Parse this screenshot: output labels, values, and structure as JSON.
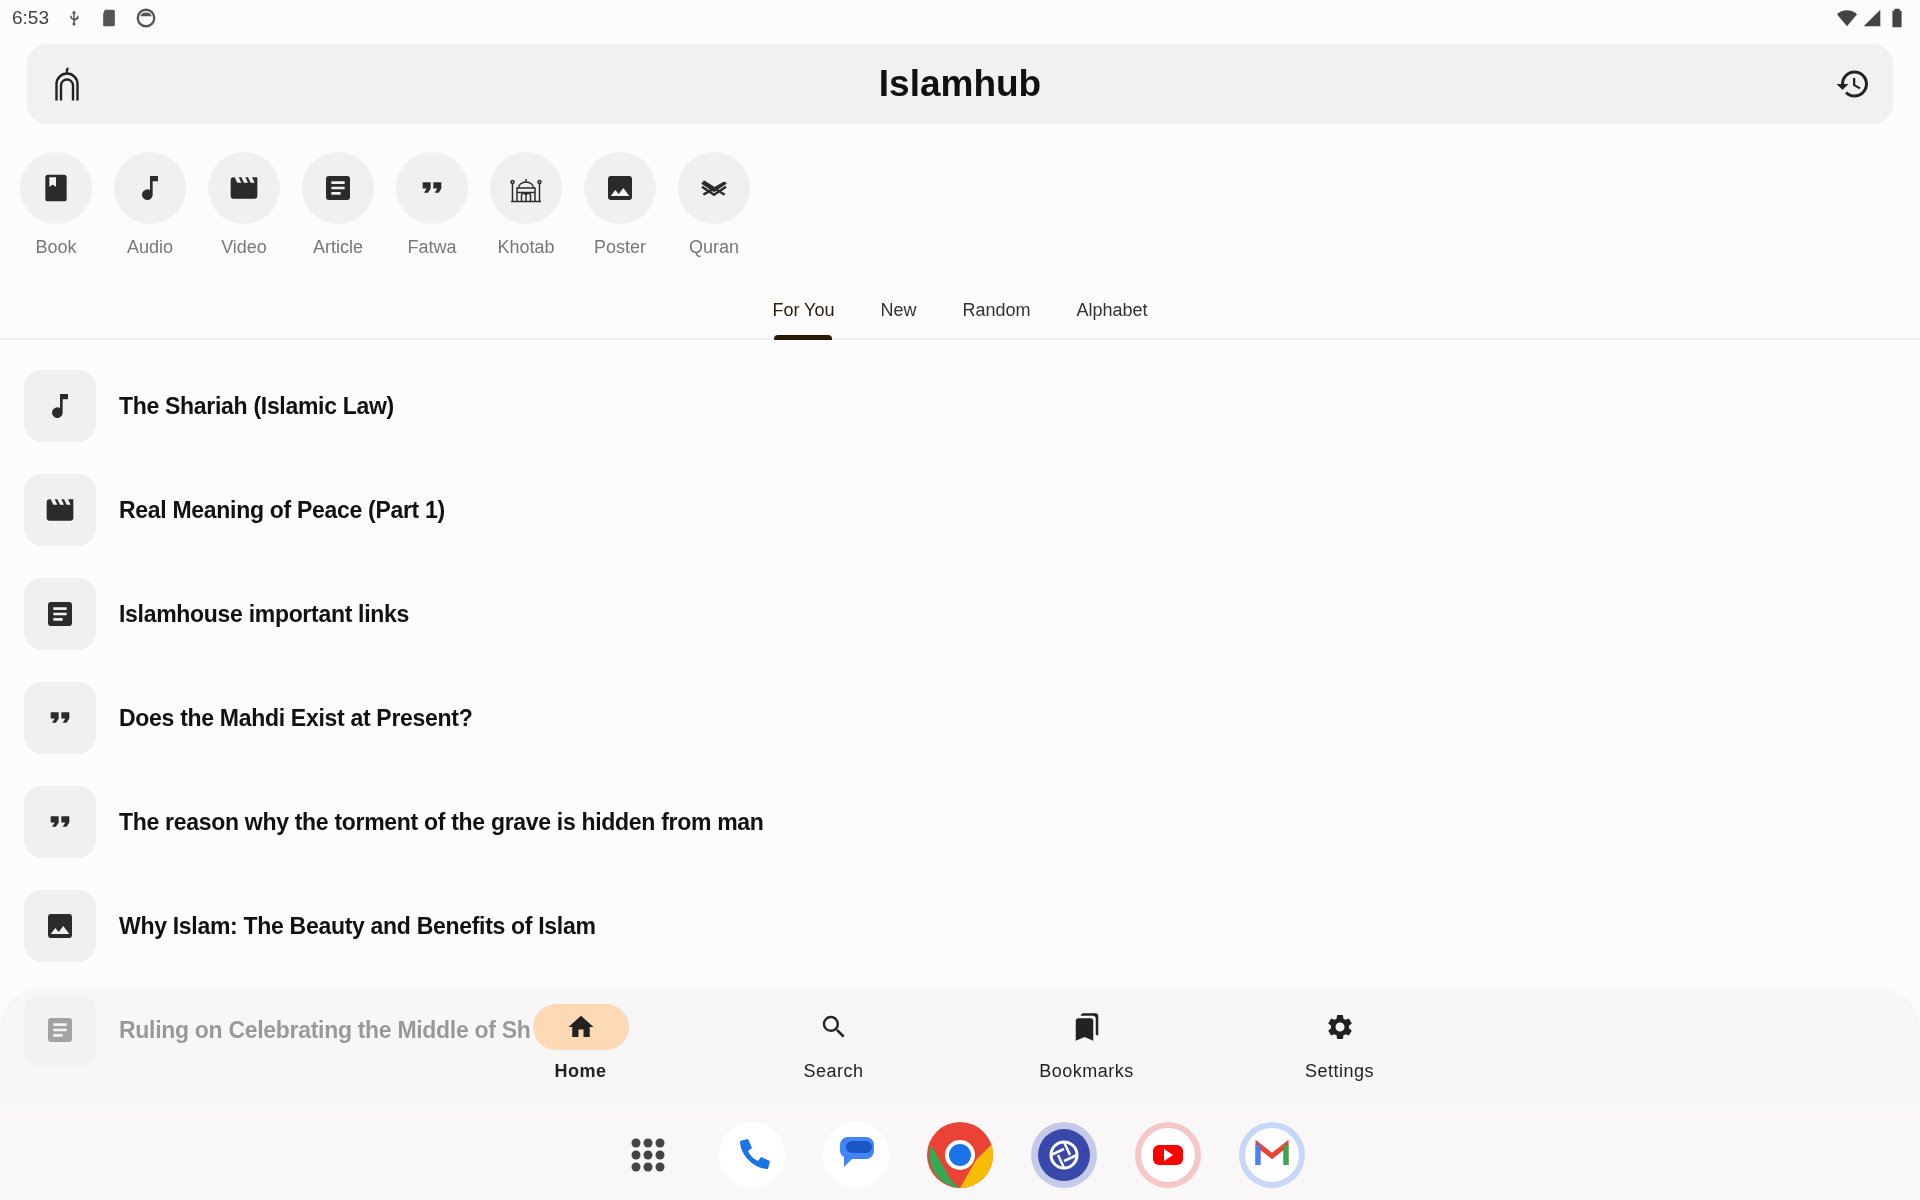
{
  "status_bar": {
    "time": "6:53"
  },
  "app_bar": {
    "title": "Islamhub"
  },
  "categories": [
    {
      "label": "Book",
      "kind": "book"
    },
    {
      "label": "Audio",
      "kind": "audio"
    },
    {
      "label": "Video",
      "kind": "video"
    },
    {
      "label": "Article",
      "kind": "article"
    },
    {
      "label": "Fatwa",
      "kind": "fatwa"
    },
    {
      "label": "Khotab",
      "kind": "khotab"
    },
    {
      "label": "Poster",
      "kind": "poster"
    },
    {
      "label": "Quran",
      "kind": "quran"
    }
  ],
  "tabs": [
    {
      "label": "For You",
      "selected": true
    },
    {
      "label": "New",
      "selected": false
    },
    {
      "label": "Random",
      "selected": false
    },
    {
      "label": "Alphabet",
      "selected": false
    }
  ],
  "items": [
    {
      "title": "The Shariah (Islamic Law)",
      "kind": "audio"
    },
    {
      "title": "Real Meaning of Peace (Part 1)",
      "kind": "video"
    },
    {
      "title": "Islamhouse important links",
      "kind": "article"
    },
    {
      "title": "Does the Mahdi Exist at Present?",
      "kind": "fatwa"
    },
    {
      "title": "The reason why the torment of the grave is hidden from man",
      "kind": "fatwa"
    },
    {
      "title": "Why Islam: The Beauty and Benefits of Islam",
      "kind": "poster"
    },
    {
      "title": "Ruling on Celebrating the Middle of Sh",
      "kind": "article"
    }
  ],
  "bottom_nav": [
    {
      "label": "Home",
      "kind": "home",
      "selected": true
    },
    {
      "label": "Search",
      "kind": "search",
      "selected": false
    },
    {
      "label": "Bookmarks",
      "kind": "bookmarks",
      "selected": false
    },
    {
      "label": "Settings",
      "kind": "settings",
      "selected": false
    }
  ]
}
